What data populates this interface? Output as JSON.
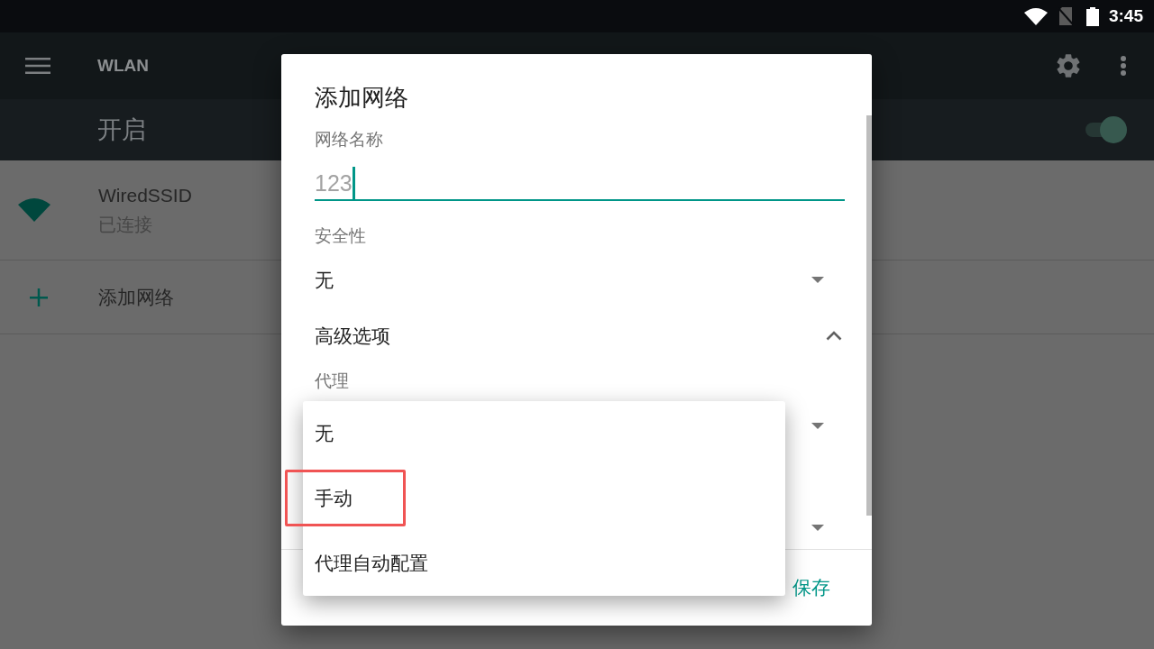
{
  "status_bar": {
    "time": "3:45"
  },
  "app_bar": {
    "title": "WLAN"
  },
  "wlan_switch": {
    "label": "开启",
    "on": true
  },
  "networks": [
    {
      "kind": "network",
      "name": "WiredSSID",
      "status": "已连接"
    },
    {
      "kind": "add",
      "name": "添加网络"
    }
  ],
  "dialog": {
    "title": "添加网络",
    "network_name": {
      "label": "网络名称",
      "value": "123"
    },
    "security": {
      "label": "安全性",
      "value": "无"
    },
    "advanced_options": {
      "label": "高级选项",
      "expanded": true
    },
    "proxy": {
      "label": "代理"
    },
    "buttons": [
      {
        "label": "保存"
      }
    ]
  },
  "proxy_menu": {
    "items": [
      {
        "label": "无",
        "highlighted": false
      },
      {
        "label": "手动",
        "highlighted": true
      },
      {
        "label": "代理自动配置",
        "highlighted": false
      }
    ]
  }
}
